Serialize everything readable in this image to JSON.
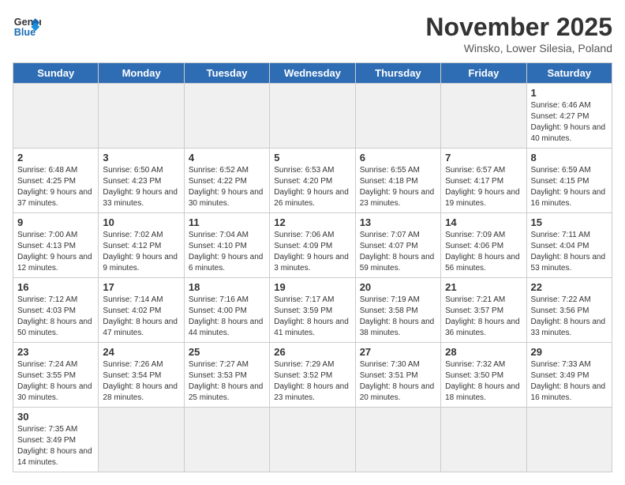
{
  "header": {
    "logo_general": "General",
    "logo_blue": "Blue",
    "month_title": "November 2025",
    "location": "Winsko, Lower Silesia, Poland"
  },
  "weekdays": [
    "Sunday",
    "Monday",
    "Tuesday",
    "Wednesday",
    "Thursday",
    "Friday",
    "Saturday"
  ],
  "weeks": [
    [
      {
        "day": "",
        "info": "",
        "empty": true
      },
      {
        "day": "",
        "info": "",
        "empty": true
      },
      {
        "day": "",
        "info": "",
        "empty": true
      },
      {
        "day": "",
        "info": "",
        "empty": true
      },
      {
        "day": "",
        "info": "",
        "empty": true
      },
      {
        "day": "",
        "info": "",
        "empty": true
      },
      {
        "day": "1",
        "info": "Sunrise: 6:46 AM\nSunset: 4:27 PM\nDaylight: 9 hours\nand 40 minutes.",
        "empty": false
      }
    ],
    [
      {
        "day": "2",
        "info": "Sunrise: 6:48 AM\nSunset: 4:25 PM\nDaylight: 9 hours\nand 37 minutes.",
        "empty": false
      },
      {
        "day": "3",
        "info": "Sunrise: 6:50 AM\nSunset: 4:23 PM\nDaylight: 9 hours\nand 33 minutes.",
        "empty": false
      },
      {
        "day": "4",
        "info": "Sunrise: 6:52 AM\nSunset: 4:22 PM\nDaylight: 9 hours\nand 30 minutes.",
        "empty": false
      },
      {
        "day": "5",
        "info": "Sunrise: 6:53 AM\nSunset: 4:20 PM\nDaylight: 9 hours\nand 26 minutes.",
        "empty": false
      },
      {
        "day": "6",
        "info": "Sunrise: 6:55 AM\nSunset: 4:18 PM\nDaylight: 9 hours\nand 23 minutes.",
        "empty": false
      },
      {
        "day": "7",
        "info": "Sunrise: 6:57 AM\nSunset: 4:17 PM\nDaylight: 9 hours\nand 19 minutes.",
        "empty": false
      },
      {
        "day": "8",
        "info": "Sunrise: 6:59 AM\nSunset: 4:15 PM\nDaylight: 9 hours\nand 16 minutes.",
        "empty": false
      }
    ],
    [
      {
        "day": "9",
        "info": "Sunrise: 7:00 AM\nSunset: 4:13 PM\nDaylight: 9 hours\nand 12 minutes.",
        "empty": false
      },
      {
        "day": "10",
        "info": "Sunrise: 7:02 AM\nSunset: 4:12 PM\nDaylight: 9 hours\nand 9 minutes.",
        "empty": false
      },
      {
        "day": "11",
        "info": "Sunrise: 7:04 AM\nSunset: 4:10 PM\nDaylight: 9 hours\nand 6 minutes.",
        "empty": false
      },
      {
        "day": "12",
        "info": "Sunrise: 7:06 AM\nSunset: 4:09 PM\nDaylight: 9 hours\nand 3 minutes.",
        "empty": false
      },
      {
        "day": "13",
        "info": "Sunrise: 7:07 AM\nSunset: 4:07 PM\nDaylight: 8 hours\nand 59 minutes.",
        "empty": false
      },
      {
        "day": "14",
        "info": "Sunrise: 7:09 AM\nSunset: 4:06 PM\nDaylight: 8 hours\nand 56 minutes.",
        "empty": false
      },
      {
        "day": "15",
        "info": "Sunrise: 7:11 AM\nSunset: 4:04 PM\nDaylight: 8 hours\nand 53 minutes.",
        "empty": false
      }
    ],
    [
      {
        "day": "16",
        "info": "Sunrise: 7:12 AM\nSunset: 4:03 PM\nDaylight: 8 hours\nand 50 minutes.",
        "empty": false
      },
      {
        "day": "17",
        "info": "Sunrise: 7:14 AM\nSunset: 4:02 PM\nDaylight: 8 hours\nand 47 minutes.",
        "empty": false
      },
      {
        "day": "18",
        "info": "Sunrise: 7:16 AM\nSunset: 4:00 PM\nDaylight: 8 hours\nand 44 minutes.",
        "empty": false
      },
      {
        "day": "19",
        "info": "Sunrise: 7:17 AM\nSunset: 3:59 PM\nDaylight: 8 hours\nand 41 minutes.",
        "empty": false
      },
      {
        "day": "20",
        "info": "Sunrise: 7:19 AM\nSunset: 3:58 PM\nDaylight: 8 hours\nand 38 minutes.",
        "empty": false
      },
      {
        "day": "21",
        "info": "Sunrise: 7:21 AM\nSunset: 3:57 PM\nDaylight: 8 hours\nand 36 minutes.",
        "empty": false
      },
      {
        "day": "22",
        "info": "Sunrise: 7:22 AM\nSunset: 3:56 PM\nDaylight: 8 hours\nand 33 minutes.",
        "empty": false
      }
    ],
    [
      {
        "day": "23",
        "info": "Sunrise: 7:24 AM\nSunset: 3:55 PM\nDaylight: 8 hours\nand 30 minutes.",
        "empty": false
      },
      {
        "day": "24",
        "info": "Sunrise: 7:26 AM\nSunset: 3:54 PM\nDaylight: 8 hours\nand 28 minutes.",
        "empty": false
      },
      {
        "day": "25",
        "info": "Sunrise: 7:27 AM\nSunset: 3:53 PM\nDaylight: 8 hours\nand 25 minutes.",
        "empty": false
      },
      {
        "day": "26",
        "info": "Sunrise: 7:29 AM\nSunset: 3:52 PM\nDaylight: 8 hours\nand 23 minutes.",
        "empty": false
      },
      {
        "day": "27",
        "info": "Sunrise: 7:30 AM\nSunset: 3:51 PM\nDaylight: 8 hours\nand 20 minutes.",
        "empty": false
      },
      {
        "day": "28",
        "info": "Sunrise: 7:32 AM\nSunset: 3:50 PM\nDaylight: 8 hours\nand 18 minutes.",
        "empty": false
      },
      {
        "day": "29",
        "info": "Sunrise: 7:33 AM\nSunset: 3:49 PM\nDaylight: 8 hours\nand 16 minutes.",
        "empty": false
      }
    ],
    [
      {
        "day": "30",
        "info": "Sunrise: 7:35 AM\nSunset: 3:49 PM\nDaylight: 8 hours\nand 14 minutes.",
        "empty": false
      },
      {
        "day": "",
        "info": "",
        "empty": true
      },
      {
        "day": "",
        "info": "",
        "empty": true
      },
      {
        "day": "",
        "info": "",
        "empty": true
      },
      {
        "day": "",
        "info": "",
        "empty": true
      },
      {
        "day": "",
        "info": "",
        "empty": true
      },
      {
        "day": "",
        "info": "",
        "empty": true
      }
    ]
  ]
}
